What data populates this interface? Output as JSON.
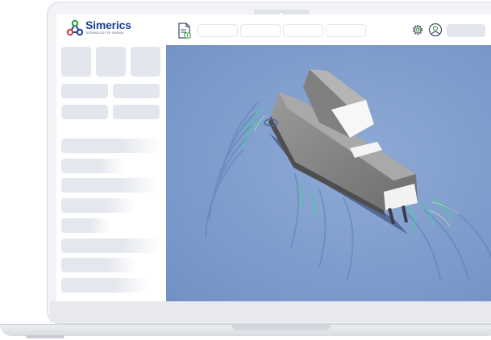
{
  "app": {
    "brand_name": "Simerics",
    "brand_tagline": "TECHNOLOGY OF DESIGN",
    "brand_color": "#1f3f93"
  },
  "header": {
    "icons": [
      "file-icon",
      "settings-icon",
      "user-icon"
    ],
    "tab_count": 4
  },
  "viewport": {
    "background_color": "#7f9dcc",
    "axis_label": "",
    "scene": "ship-wake-simulation"
  },
  "colors": {
    "placeholder": "#e3e6ec",
    "wake_green": "#3fd19a",
    "hull": "#8e8e8e"
  }
}
